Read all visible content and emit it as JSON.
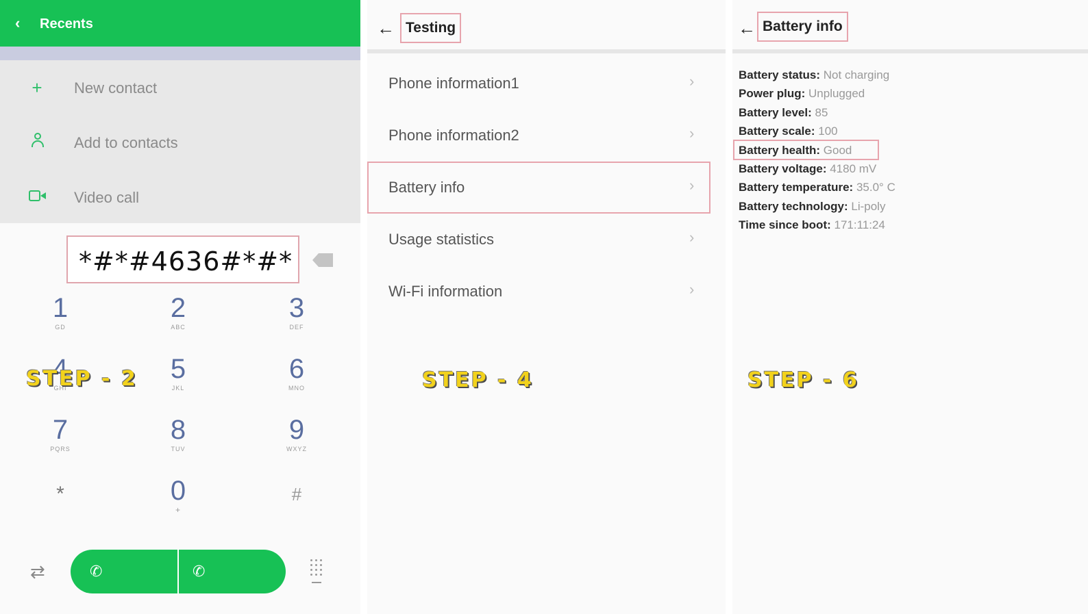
{
  "panel1": {
    "header": {
      "back_icon": "chevron-left-icon",
      "title": "Recents"
    },
    "menu": [
      {
        "icon": "plus-icon",
        "label": "New contact"
      },
      {
        "icon": "person-icon",
        "label": "Add to contacts"
      },
      {
        "icon": "video-camera-icon",
        "label": "Video call"
      }
    ],
    "dial_input": "*#*#4636#*#*",
    "keypad": [
      {
        "digit": "1",
        "letters": "GD"
      },
      {
        "digit": "2",
        "letters": "ABC"
      },
      {
        "digit": "3",
        "letters": "DEF"
      },
      {
        "digit": "4",
        "letters": "GHI"
      },
      {
        "digit": "5",
        "letters": "JKL"
      },
      {
        "digit": "6",
        "letters": "MNO"
      },
      {
        "digit": "7",
        "letters": "PQRS"
      },
      {
        "digit": "8",
        "letters": "TUV"
      },
      {
        "digit": "9",
        "letters": "WXYZ"
      },
      {
        "digit": "*",
        "letters": ""
      },
      {
        "digit": "0",
        "letters": "+"
      },
      {
        "digit": "#",
        "letters": ""
      }
    ],
    "step_label": "STEP - 2"
  },
  "panel2": {
    "title": "Testing",
    "items": [
      {
        "label": "Phone information1"
      },
      {
        "label": "Phone information2"
      },
      {
        "label": "Battery info"
      },
      {
        "label": "Usage statistics"
      },
      {
        "label": "Wi-Fi information"
      }
    ],
    "selected_item": "Battery info",
    "step_label": "STEP - 4"
  },
  "panel3": {
    "title": "Battery info",
    "fields": [
      {
        "key": "Battery status:",
        "value": "Not charging"
      },
      {
        "key": "Power plug:",
        "value": "Unplugged"
      },
      {
        "key": "Battery level:",
        "value": "85"
      },
      {
        "key": "Battery scale:",
        "value": "100"
      },
      {
        "key": "Battery health:",
        "value": "Good"
      },
      {
        "key": "Battery voltage:",
        "value": "4180 mV"
      },
      {
        "key": "Battery temperature:",
        "value": "35.0° C"
      },
      {
        "key": "Battery technology:",
        "value": "Li-poly"
      },
      {
        "key": "Time since boot:",
        "value": "171:11:24"
      }
    ],
    "highlighted_field": "Battery health:",
    "step_label": "STEP - 6"
  },
  "colors": {
    "accent_green": "#17c155",
    "highlight_border": "#e7a4ad",
    "step_text": "#f2d21c"
  }
}
